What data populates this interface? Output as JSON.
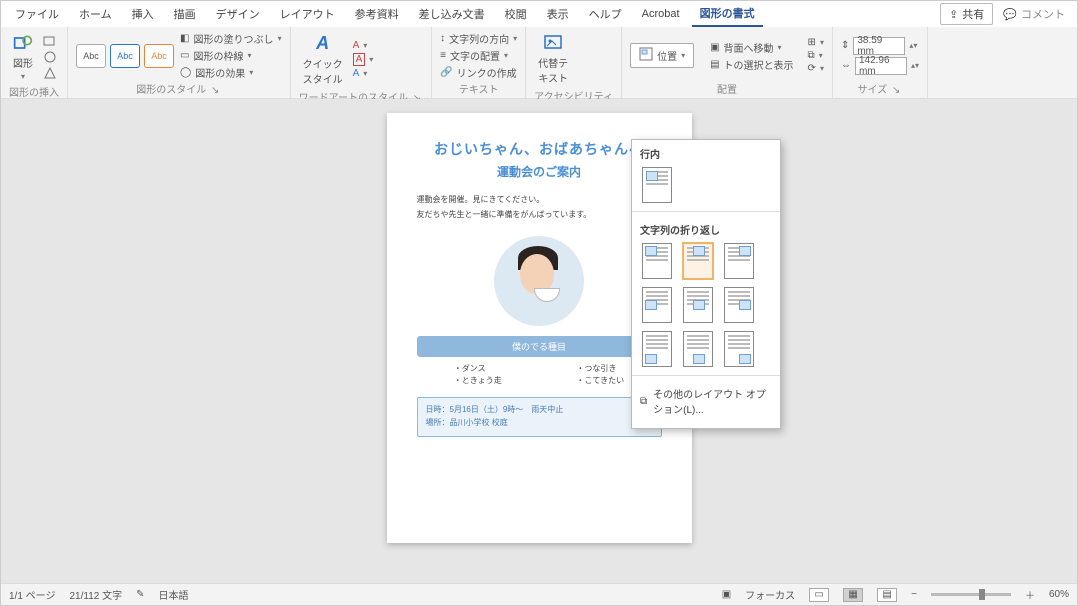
{
  "tabs": {
    "items": [
      "ファイル",
      "ホーム",
      "挿入",
      "描画",
      "デザイン",
      "レイアウト",
      "参考資料",
      "差し込み文書",
      "校閲",
      "表示",
      "ヘルプ",
      "Acrobat",
      "図形の書式"
    ],
    "active_index": 12,
    "share": "共有",
    "comment": "コメント"
  },
  "ribbon": {
    "insert_shape": {
      "btn": "図形",
      "label": "図形の挿入"
    },
    "shape_style": {
      "fill": "図形の塗りつぶし",
      "outline": "図形の枠線",
      "effects": "図形の効果",
      "label": "図形のスタイル"
    },
    "wordart": {
      "btn": "クイック\nスタイル",
      "label": "ワードアートのスタイル"
    },
    "text": {
      "dir": "文字列の方向",
      "align": "文字の配置",
      "link": "リンクの作成",
      "label": "テキスト"
    },
    "acc": {
      "btn": "代替テ\nキスト",
      "label": "アクセシビリティ"
    },
    "arrange": {
      "position": "位置",
      "back": "背面へ移動",
      "selpane": "トの選択と表示",
      "label": "配置"
    },
    "size": {
      "h": "38.59 mm",
      "w": "142.96 mm",
      "label": "サイズ"
    }
  },
  "dropdown": {
    "sec1": "行内",
    "sec2": "文字列の折り返し",
    "more": "その他のレイアウト オプション(L)..."
  },
  "doc": {
    "h1": "おじいちゃん、おばあちゃんへ",
    "h2": "運動会のご案内",
    "p1": "運動会を開催。見にきてください。",
    "p2": "友だちや先生と一緒に準備をがんばっています。",
    "band": "僕のでる種目",
    "col1a": "・ダンス",
    "col1b": "・ときょう走",
    "col2a": "・つな引き",
    "col2b": "・こてきたい",
    "info1": "日時：5月16日（土）9時～　雨天中止",
    "info2": "場所：品川小学校 校庭"
  },
  "status": {
    "page": "1/1 ページ",
    "words": "21/112 文字",
    "lang": "日本語",
    "focus": "フォーカス",
    "zoom": "60%"
  }
}
